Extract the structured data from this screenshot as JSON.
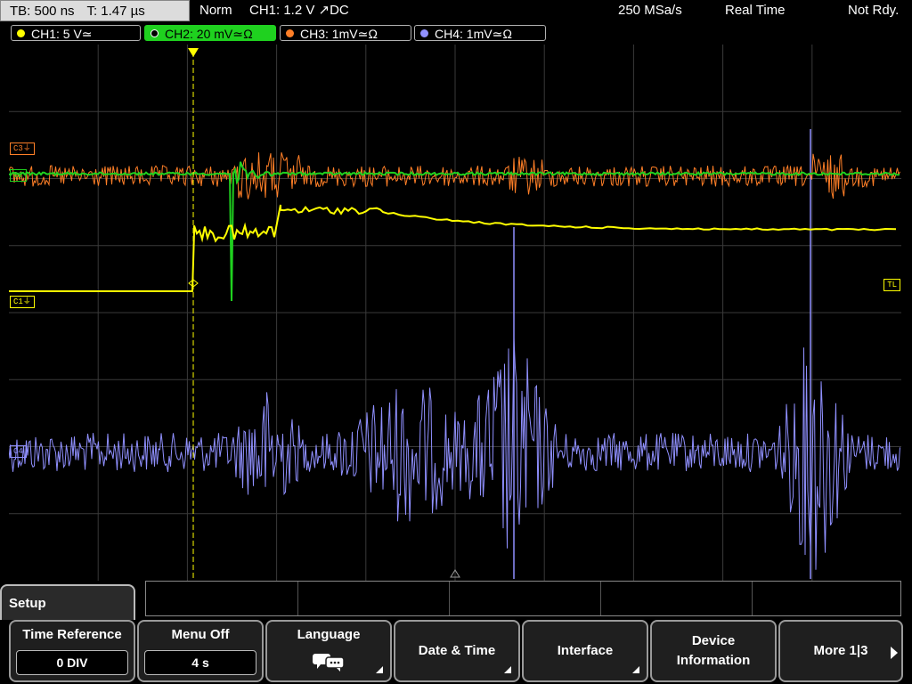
{
  "header": {
    "tb": "TB: 500 ns",
    "t": "T: 1.47 µs",
    "mode": "Norm",
    "trigger": "CH1: 1.2 V ↗DC",
    "sample_rate": "250 MSa/s",
    "acq": "Real Time",
    "ready": "Not Rdy."
  },
  "channels": [
    {
      "label": "CH1: 5 V≃",
      "color": "#ffff00",
      "active": false
    },
    {
      "label": "CH2: 20 mV≃Ω",
      "color": "#1fd11f",
      "active": true
    },
    {
      "label": "CH3: 1mV≃Ω",
      "color": "#ff7f27",
      "active": false
    },
    {
      "label": "CH4: 1mV≃Ω",
      "color": "#9090ff",
      "active": false
    }
  ],
  "markers": {
    "c3": "C3⏚",
    "c2": "C2",
    "c1": "C1⏚",
    "c4": "C4",
    "tl": "TL"
  },
  "menu": {
    "tab": "Setup",
    "keys": [
      {
        "title": "Time Reference",
        "value": "0 DIV"
      },
      {
        "title": "Menu Off",
        "value": "4 s"
      },
      {
        "title": "Language",
        "icon": "speech-bubbles-icon"
      },
      {
        "title": "Date & Time"
      },
      {
        "title": "Interface"
      },
      {
        "title": "Device Information"
      },
      {
        "title": "More 1|3"
      }
    ]
  },
  "colors": {
    "ch1": "#ffff00",
    "ch2": "#1fd11f",
    "ch3": "#ff7f27",
    "ch4": "#9090ff",
    "grid": "#3a3a3a"
  }
}
